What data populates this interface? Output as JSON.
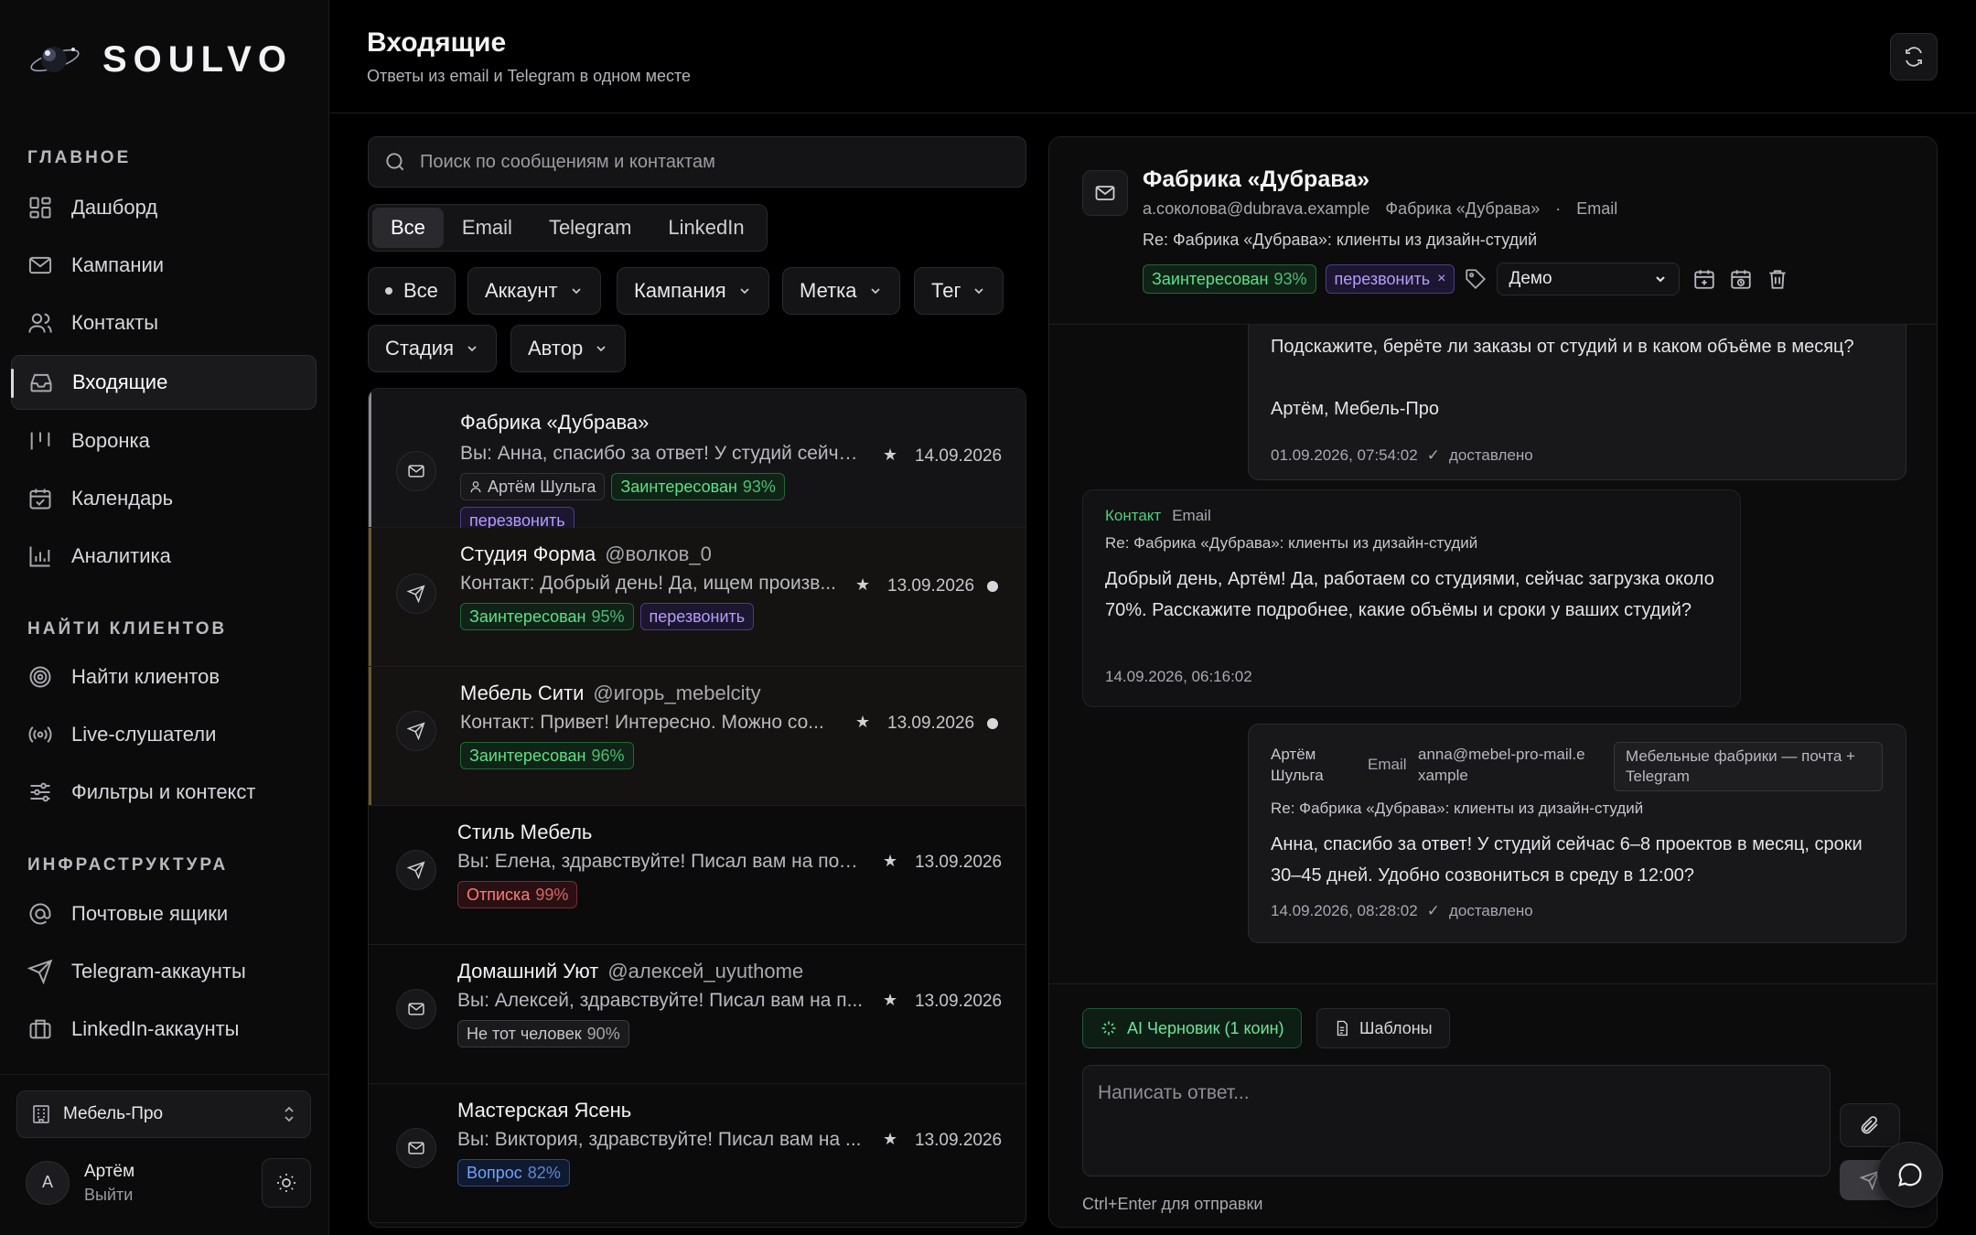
{
  "app": {
    "brand": "SOULVO"
  },
  "sidebar": {
    "sections": [
      {
        "title": "ГЛАВНОЕ",
        "items": [
          {
            "label": "Дашборд",
            "icon": "dashboard-icon"
          },
          {
            "label": "Кампании",
            "icon": "mail-icon"
          },
          {
            "label": "Контакты",
            "icon": "users-icon"
          },
          {
            "label": "Входящие",
            "icon": "inbox-icon",
            "active": true
          },
          {
            "label": "Воронка",
            "icon": "funnel-icon"
          },
          {
            "label": "Календарь",
            "icon": "calendar-icon"
          },
          {
            "label": "Аналитика",
            "icon": "chart-icon"
          }
        ]
      },
      {
        "title": "НАЙТИ КЛИЕНТОВ",
        "items": [
          {
            "label": "Найти клиентов",
            "icon": "target-icon"
          },
          {
            "label": "Live-слушатели",
            "icon": "broadcast-icon"
          },
          {
            "label": "Фильтры и контекст",
            "icon": "sliders-icon"
          }
        ]
      },
      {
        "title": "ИНФРАСТРУКТУРА",
        "items": [
          {
            "label": "Почтовые ящики",
            "icon": "at-icon"
          },
          {
            "label": "Telegram-аккаунты",
            "icon": "send-icon"
          },
          {
            "label": "LinkedIn-аккаунты",
            "icon": "briefcase-icon"
          }
        ]
      }
    ],
    "workspace": "Мебель-Про",
    "user": {
      "initial": "А",
      "name": "Артём",
      "logout": "Выйти"
    }
  },
  "header": {
    "title": "Входящие",
    "subtitle": "Ответы из email и Telegram в одном месте"
  },
  "search": {
    "placeholder": "Поиск по сообщениям и контактам"
  },
  "channel_tabs": [
    "Все",
    "Email",
    "Telegram",
    "LinkedIn"
  ],
  "filters": {
    "all": "Все",
    "account": "Аккаунт",
    "campaign": "Кампания",
    "label": "Метка",
    "tag": "Тег",
    "stage": "Стадия",
    "author": "Автор"
  },
  "conversations": [
    {
      "name": "Фабрика «Дубрава»",
      "handle": "",
      "channel": "email",
      "preview": "Вы: Анна, спасибо за ответ! У студий сейча...",
      "author": "Артём Шульга",
      "tags": [
        {
          "kind": "green",
          "text": "Заинтересован",
          "pct": "93%"
        },
        {
          "kind": "purple",
          "text": "перезвонить",
          "pct": ""
        }
      ],
      "date": "14.09.2026",
      "unread": false
    },
    {
      "name": "Студия Форма",
      "handle": "@волков_0",
      "channel": "telegram",
      "preview": "Контакт: Добрый день! Да, ищем произв...",
      "author": "",
      "tags": [
        {
          "kind": "green",
          "text": "Заинтересован",
          "pct": "95%"
        },
        {
          "kind": "purple",
          "text": "перезвонить",
          "pct": ""
        }
      ],
      "date": "13.09.2026",
      "unread": true
    },
    {
      "name": "Мебель Сити",
      "handle": "@игорь_mebelcity",
      "channel": "telegram",
      "preview": "Контакт: Привет! Интересно. Можно со...",
      "author": "",
      "tags": [
        {
          "kind": "green",
          "text": "Заинтересован",
          "pct": "96%"
        }
      ],
      "date": "13.09.2026",
      "unread": true
    },
    {
      "name": "Стиль Мебель",
      "handle": "",
      "channel": "telegram",
      "preview": "Вы: Елена, здравствуйте! Писал вам на поч...",
      "author": "",
      "tags": [
        {
          "kind": "red",
          "text": "Отписка",
          "pct": "99%"
        }
      ],
      "date": "13.09.2026",
      "unread": false
    },
    {
      "name": "Домашний Уют",
      "handle": "@алексей_uyuthome",
      "channel": "email",
      "preview": "Вы: Алексей, здравствуйте! Писал вам на п...",
      "author": "",
      "tags": [
        {
          "kind": "gray",
          "text": "Не тот человек",
          "pct": "90%"
        }
      ],
      "date": "13.09.2026",
      "unread": false
    },
    {
      "name": "Мастерская Ясень",
      "handle": "",
      "channel": "email",
      "preview": "Вы: Виктория, здравствуйте! Писал вам на ...",
      "author": "",
      "tags": [
        {
          "kind": "blue",
          "text": "Вопрос",
          "pct": "82%"
        }
      ],
      "date": "13.09.2026",
      "unread": false
    }
  ],
  "detail": {
    "title": "Фабрика «Дубрава»",
    "email": "a.соколова@dubrava.example",
    "company": "Фабрика «Дубрава»",
    "channel": "Email",
    "subject": "Re: Фабрика «Дубрава»: клиенты из дизайн-студий",
    "tag_interest": "Заинтересован",
    "tag_interest_pct": "93%",
    "tag_callback": "перезвонить",
    "stage": "Демо",
    "messages": [
      {
        "lines": [
          "Подскажите, берёте ли заказы от студий и в каком объёме в месяц?",
          "",
          "Артём, Мебель-Про"
        ],
        "time": "01.09.2026, 07:54:02",
        "status": "доставлено"
      },
      {
        "sender": "Контакт",
        "channel": "Email",
        "subject": "Re: Фабрика «Дубрава»: клиенты из дизайн-студий",
        "text": "Добрый день, Артём! Да, работаем со студиями, сейчас загрузка около 70%. Расскажите подробнее, какие объёмы и сроки у ваших студий?",
        "time": "14.09.2026, 06:16:02"
      },
      {
        "sender": "Артём Шульга",
        "channel": "Email",
        "from": "anna@mebel-pro-mail.example",
        "campaign": "Мебельные фабрики — почта + Telegram",
        "subject": "Re: Фабрика «Дубрава»: клиенты из дизайн-студий",
        "text": "Анна, спасибо за ответ! У студий сейчас 6–8 проектов в месяц, сроки 30–45 дней. Удобно созвониться в среду в 12:00?",
        "time": "14.09.2026, 08:28:02",
        "status": "доставлено"
      }
    ]
  },
  "composer": {
    "ai_label": "AI Черновик (1 коин)",
    "templates_label": "Шаблоны",
    "placeholder": "Написать ответ...",
    "hint": "Ctrl+Enter для отправки"
  }
}
